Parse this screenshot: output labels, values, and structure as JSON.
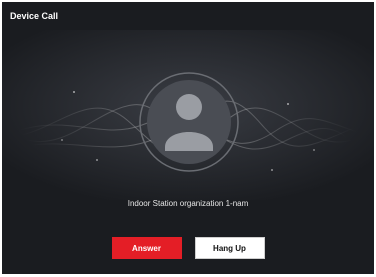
{
  "dialog": {
    "title": "Device Call",
    "caller_name": "Indoor Station organization 1-nam",
    "buttons": {
      "answer_label": "Answer",
      "hangup_label": "Hang Up"
    }
  },
  "theme": {
    "background": "#1a1c20",
    "answer_color": "#e41e26",
    "hangup_color": "#ffffff"
  },
  "icons": {
    "avatar": "person-silhouette-icon"
  }
}
